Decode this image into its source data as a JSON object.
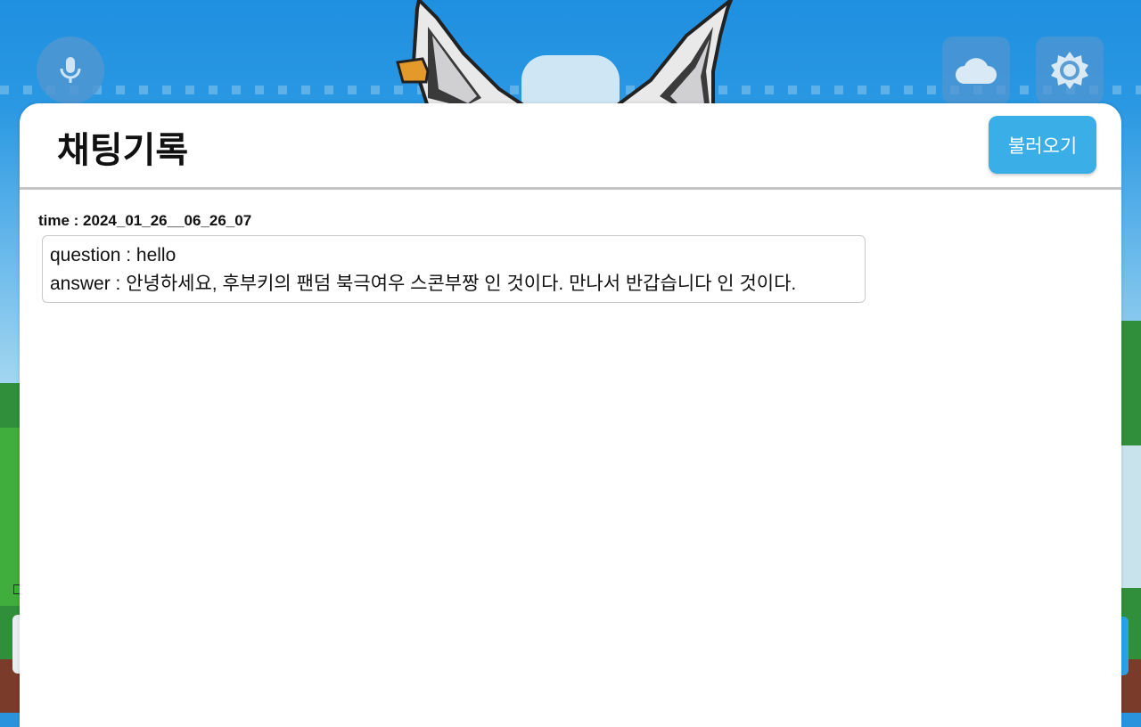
{
  "toolbar": {
    "mic_icon": "microphone-icon",
    "cloud_icon": "cloud-icon",
    "settings_icon": "gear-icon"
  },
  "chat_history": {
    "title": "채팅기록",
    "load_button": "불러오기",
    "entries": [
      {
        "time_label": "time : 2024_01_26__06_26_07",
        "question": "question : hello",
        "answer": "answer : 안녕하세요, 후부키의 팬덤 북극여우 스콘부짱 인 것이다. 만나서 반갑습니다 인 것이다."
      }
    ]
  },
  "colors": {
    "accent": "#3aaee6",
    "panel": "#ffffff",
    "sky": "#2a93de"
  }
}
